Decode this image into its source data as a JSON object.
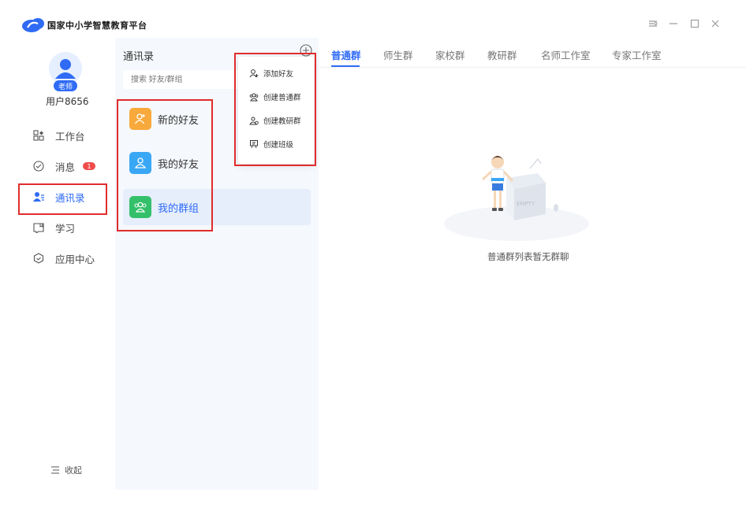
{
  "app": {
    "title": "国家中小学智慧教育平台"
  },
  "window_controls": {
    "settings_icon": "settings-icon",
    "minimize_icon": "minimize-icon",
    "maximize_icon": "maximize-icon",
    "close_icon": "close-icon"
  },
  "user": {
    "role_badge": "老师",
    "name": "用户8656"
  },
  "sidebar": {
    "items": [
      {
        "label": "工作台",
        "icon": "grid-icon"
      },
      {
        "label": "消息",
        "icon": "message-icon",
        "badge": "1"
      },
      {
        "label": "通讯录",
        "icon": "contacts-icon",
        "active": true
      },
      {
        "label": "学习",
        "icon": "study-icon"
      },
      {
        "label": "应用中心",
        "icon": "app-center-icon"
      }
    ],
    "collapse_label": "收起"
  },
  "contacts": {
    "title": "通讯录",
    "search_placeholder": "搜索 好友/群组",
    "items": [
      {
        "label": "新的好友",
        "color": "#f7a93b"
      },
      {
        "label": "我的好友",
        "color": "#3aa7f5"
      },
      {
        "label": "我的群组",
        "color": "#34c06a",
        "active": true
      }
    ]
  },
  "menu": {
    "items": [
      {
        "label": "添加好友",
        "icon": "add-friend-icon"
      },
      {
        "label": "创建普通群",
        "icon": "create-group-icon"
      },
      {
        "label": "创建教研群",
        "icon": "create-research-group-icon"
      },
      {
        "label": "创建班级",
        "icon": "create-class-icon"
      }
    ]
  },
  "tabs": [
    {
      "label": "普通群",
      "active": true
    },
    {
      "label": "师生群"
    },
    {
      "label": "家校群"
    },
    {
      "label": "教研群"
    },
    {
      "label": "名师工作室"
    },
    {
      "label": "专家工作室"
    }
  ],
  "empty_state": {
    "text": "普通群列表暂无群聊",
    "box_label": "EMPTY"
  },
  "colors": {
    "accent": "#2f6bf5",
    "highlight": "#e02d2d",
    "badge": "#f04b4b"
  }
}
